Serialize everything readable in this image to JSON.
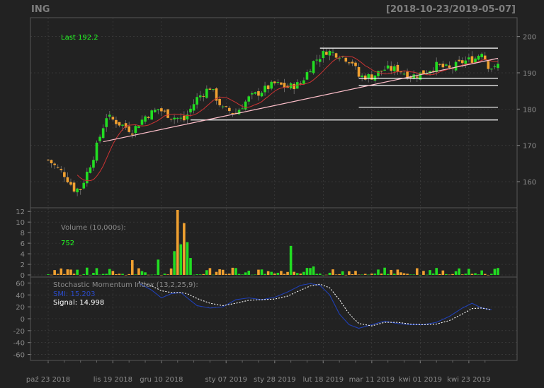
{
  "symbol": "ING",
  "date_range": "[2018-10-23/2019-05-07]",
  "colors": {
    "background": "#222222",
    "panel_border": "#555555",
    "grid": "#444444",
    "up": "#22dd22",
    "down": "#f0a030",
    "trend": "#ffc0cb",
    "ma": "#cc3333",
    "hline": "#ffffff",
    "smi": "#1f3fb4",
    "signal": "#ffffff",
    "text": "#8a8a8a",
    "last": "#22ff22"
  },
  "chart_data": [
    {
      "type": "candlestick",
      "last_label": "Last 192.2",
      "y_ticks": [
        160,
        170,
        180,
        190,
        200
      ],
      "ylim": [
        153,
        205
      ],
      "x_labels": [
        "paź 23 2018",
        "lis 19 2018",
        "gru 10 2018",
        "sty 07 2019",
        "sty 28 2019",
        "lut 18 2019",
        "mar 11 2019",
        "kwi 01 2019",
        "kwi 23 2019"
      ],
      "x_label_index": [
        0,
        20,
        35,
        55,
        70,
        85,
        100,
        115,
        130
      ],
      "n_bars": 140,
      "anchors": [
        [
          0,
          166
        ],
        [
          5,
          162
        ],
        [
          8,
          158
        ],
        [
          10,
          158
        ],
        [
          14,
          167
        ],
        [
          18,
          178
        ],
        [
          22,
          176
        ],
        [
          26,
          174
        ],
        [
          30,
          178
        ],
        [
          34,
          180
        ],
        [
          38,
          178
        ],
        [
          42,
          177
        ],
        [
          46,
          183
        ],
        [
          50,
          186
        ],
        [
          54,
          180
        ],
        [
          58,
          179
        ],
        [
          62,
          183
        ],
        [
          66,
          185
        ],
        [
          70,
          187
        ],
        [
          74,
          186
        ],
        [
          78,
          187
        ],
        [
          82,
          193
        ],
        [
          86,
          196
        ],
        [
          90,
          195
        ],
        [
          94,
          193
        ],
        [
          96,
          189
        ],
        [
          100,
          189
        ],
        [
          104,
          191
        ],
        [
          108,
          191
        ],
        [
          112,
          189
        ],
        [
          116,
          190
        ],
        [
          120,
          192
        ],
        [
          124,
          191
        ],
        [
          128,
          193
        ],
        [
          132,
          194
        ],
        [
          134,
          196
        ],
        [
          136,
          192
        ],
        [
          138,
          191
        ],
        [
          139,
          192.2
        ]
      ],
      "support_resistance": [
        196.8,
        188.5,
        186.5,
        180.5,
        177
      ],
      "trendline": {
        "from": [
          17,
          171
        ],
        "to": [
          139,
          194
        ]
      }
    },
    {
      "type": "bar",
      "label": "Volume (10,000s):",
      "value": "752",
      "y_ticks": [
        0,
        2,
        4,
        6,
        8,
        10,
        12
      ],
      "ylim": [
        0,
        12.3
      ],
      "spikes": [
        [
          40,
          12.3
        ],
        [
          41,
          5.8
        ],
        [
          42,
          9.8
        ],
        [
          43,
          6.2
        ],
        [
          39,
          4.5
        ],
        [
          44,
          3.2
        ],
        [
          75,
          5.5
        ],
        [
          26,
          2.8
        ],
        [
          34,
          2.9
        ],
        [
          82,
          1.6
        ]
      ]
    },
    {
      "type": "line",
      "label": "Stochastic Momentum Index (13,2,25,9):",
      "series": [
        {
          "name": "SMI: 15.203",
          "values": []
        },
        {
          "name": "Signal: 14.998",
          "values": []
        }
      ],
      "y_ticks": [
        60,
        40,
        20,
        0,
        -20,
        -40,
        -60
      ],
      "ylim": [
        -70,
        70
      ],
      "smi_anchors": [
        [
          28,
          60
        ],
        [
          32,
          48
        ],
        [
          35,
          35
        ],
        [
          38,
          42
        ],
        [
          41,
          44
        ],
        [
          43,
          35
        ],
        [
          46,
          22
        ],
        [
          50,
          18
        ],
        [
          54,
          20
        ],
        [
          58,
          32
        ],
        [
          62,
          35
        ],
        [
          66,
          32
        ],
        [
          70,
          36
        ],
        [
          74,
          45
        ],
        [
          78,
          56
        ],
        [
          81,
          59
        ],
        [
          84,
          56
        ],
        [
          87,
          40
        ],
        [
          90,
          8
        ],
        [
          93,
          -10
        ],
        [
          96,
          -16
        ],
        [
          100,
          -10
        ],
        [
          104,
          -4
        ],
        [
          108,
          -8
        ],
        [
          112,
          -10
        ],
        [
          116,
          -10
        ],
        [
          120,
          -6
        ],
        [
          124,
          4
        ],
        [
          128,
          18
        ],
        [
          131,
          26
        ],
        [
          134,
          18
        ],
        [
          137,
          15.2
        ]
      ],
      "signal_anchors": [
        [
          28,
          62
        ],
        [
          32,
          55
        ],
        [
          35,
          47
        ],
        [
          38,
          44
        ],
        [
          41,
          44
        ],
        [
          43,
          42
        ],
        [
          46,
          34
        ],
        [
          50,
          26
        ],
        [
          54,
          22
        ],
        [
          58,
          26
        ],
        [
          62,
          31
        ],
        [
          66,
          32
        ],
        [
          70,
          33
        ],
        [
          74,
          38
        ],
        [
          78,
          48
        ],
        [
          81,
          55
        ],
        [
          84,
          58
        ],
        [
          87,
          52
        ],
        [
          90,
          32
        ],
        [
          93,
          8
        ],
        [
          96,
          -8
        ],
        [
          100,
          -12
        ],
        [
          104,
          -6
        ],
        [
          108,
          -6
        ],
        [
          112,
          -9
        ],
        [
          116,
          -10
        ],
        [
          120,
          -9
        ],
        [
          124,
          -3
        ],
        [
          128,
          8
        ],
        [
          131,
          17
        ],
        [
          134,
          18
        ],
        [
          137,
          15.0
        ]
      ]
    }
  ]
}
